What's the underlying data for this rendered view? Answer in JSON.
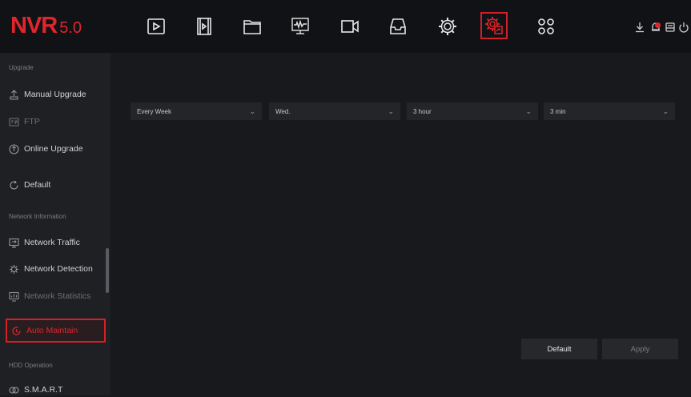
{
  "app": {
    "logo_main": "NVR",
    "logo_version": "5.0"
  },
  "toolbar": {
    "icons": [
      "playback-icon",
      "video-clip-icon",
      "folder-icon",
      "monitor-waveform-icon",
      "camera-icon",
      "inbox-icon",
      "settings-gear-icon",
      "maintenance-gear-icon",
      "apps-grid-icon"
    ],
    "active": "maintenance-gear-icon",
    "accent_color": "#d42026"
  },
  "status": {
    "icons": [
      "download-icon",
      "alarm-icon",
      "storage-icon",
      "power-icon"
    ]
  },
  "sidebar": {
    "sections": [
      {
        "title": "Upgrade"
      },
      {
        "title": "Network Information"
      },
      {
        "title": "HDD Operation"
      }
    ],
    "items": [
      {
        "label": "Manual Upgrade"
      },
      {
        "label": "FTP"
      },
      {
        "label": "Online Upgrade"
      },
      {
        "label": "Default"
      },
      {
        "label": "Network Traffic"
      },
      {
        "label": "Network Detection"
      },
      {
        "label": "Network Statistics"
      },
      {
        "label": "Auto Maintain"
      },
      {
        "label": "S.M.A.R.T"
      }
    ],
    "active_item": "Auto Maintain"
  },
  "main": {
    "selects": [
      {
        "value": "Every Week"
      },
      {
        "value": "Wed."
      },
      {
        "value": "3 hour"
      },
      {
        "value": "3 min"
      }
    ],
    "default_button": "Default",
    "apply_button": "Apply"
  }
}
